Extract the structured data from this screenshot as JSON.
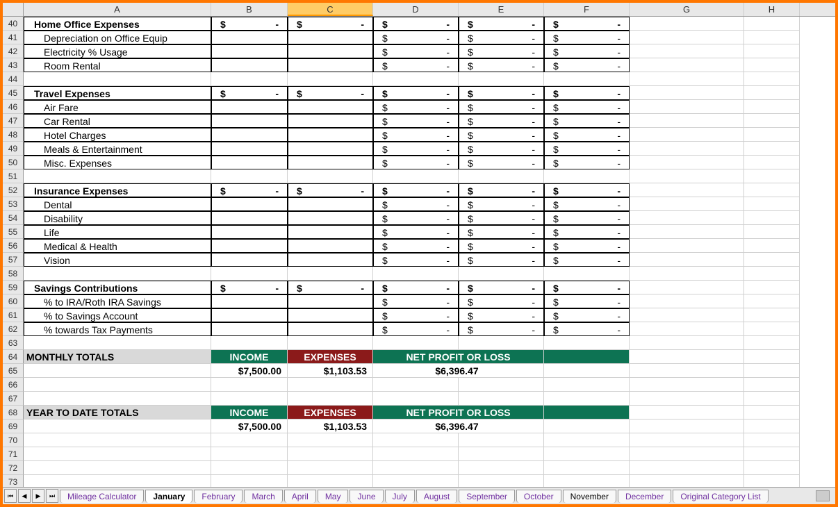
{
  "cols": [
    "A",
    "B",
    "C",
    "D",
    "E",
    "F",
    "G",
    "H"
  ],
  "selectedCol": "C",
  "sections": [
    {
      "row": 40,
      "title": "Home Office Expenses",
      "totals": [
        "B",
        "C",
        "D",
        "E",
        "F"
      ],
      "items": [
        {
          "row": 41,
          "label": "Depreciation on Office Equip",
          "cells": [
            "D",
            "E",
            "F"
          ]
        },
        {
          "row": 42,
          "label": "Electricity % Usage",
          "cells": [
            "D",
            "E",
            "F"
          ]
        },
        {
          "row": 43,
          "label": "Room Rental",
          "cells": [
            "D",
            "E",
            "F"
          ]
        }
      ],
      "blank": 44
    },
    {
      "row": 45,
      "title": "Travel Expenses",
      "totals": [
        "B",
        "C",
        "D",
        "E",
        "F"
      ],
      "items": [
        {
          "row": 46,
          "label": "Air Fare",
          "cells": [
            "D",
            "E",
            "F"
          ]
        },
        {
          "row": 47,
          "label": "Car Rental",
          "cells": [
            "D",
            "E",
            "F"
          ]
        },
        {
          "row": 48,
          "label": "Hotel Charges",
          "cells": [
            "D",
            "E",
            "F"
          ]
        },
        {
          "row": 49,
          "label": "Meals & Entertainment",
          "cells": [
            "D",
            "E",
            "F"
          ]
        },
        {
          "row": 50,
          "label": "Misc. Expenses",
          "cells": [
            "D",
            "E",
            "F"
          ]
        }
      ],
      "blank": 51
    },
    {
      "row": 52,
      "title": "Insurance Expenses",
      "totals": [
        "B",
        "C",
        "D",
        "E",
        "F"
      ],
      "items": [
        {
          "row": 53,
          "label": "Dental",
          "cells": [
            "D",
            "E",
            "F"
          ]
        },
        {
          "row": 54,
          "label": "Disability",
          "cells": [
            "D",
            "E",
            "F"
          ]
        },
        {
          "row": 55,
          "label": "Life",
          "cells": [
            "D",
            "E",
            "F"
          ]
        },
        {
          "row": 56,
          "label": "Medical & Health",
          "cells": [
            "D",
            "E",
            "F"
          ]
        },
        {
          "row": 57,
          "label": "Vision",
          "cells": [
            "D",
            "E",
            "F"
          ]
        }
      ],
      "blank": 58
    },
    {
      "row": 59,
      "title": "Savings Contributions",
      "totals": [
        "B",
        "C",
        "D",
        "E",
        "F"
      ],
      "items": [
        {
          "row": 60,
          "label": "% to IRA/Roth IRA Savings",
          "cells": [
            "D",
            "E",
            "F"
          ],
          "pct": true
        },
        {
          "row": 61,
          "label": "% to Savings Account",
          "cells": [
            "D",
            "E",
            "F"
          ],
          "pct": true
        },
        {
          "row": 62,
          "label": "% towards Tax Payments",
          "cells": [
            "D",
            "E",
            "F"
          ],
          "pct": true
        }
      ],
      "blank": 63
    }
  ],
  "summaries": [
    {
      "row": 64,
      "label": "MONTHLY TOTALS",
      "headers": {
        "income": "INCOME",
        "expenses": "EXPENSES",
        "net": "NET PROFIT OR LOSS"
      },
      "valRow": 65,
      "income": "$7,500.00",
      "expenses": "$1,103.53",
      "net": "$6,396.47",
      "blank1": 66,
      "blank2": 67
    },
    {
      "row": 68,
      "label": "YEAR TO DATE TOTALS",
      "headers": {
        "income": "INCOME",
        "expenses": "EXPENSES",
        "net": "NET PROFIT OR LOSS"
      },
      "valRow": 69,
      "income": "$7,500.00",
      "expenses": "$1,103.53",
      "net": "$6,396.47"
    }
  ],
  "trailingRows": [
    70,
    71,
    72,
    73
  ],
  "tabs": [
    "Mileage Calculator",
    "January",
    "February",
    "March",
    "April",
    "May",
    "June",
    "July",
    "August",
    "September",
    "October",
    "November",
    "December",
    "Original Category List"
  ],
  "activeTab": "January",
  "dashCell": {
    "left": "$",
    "right": "-"
  }
}
